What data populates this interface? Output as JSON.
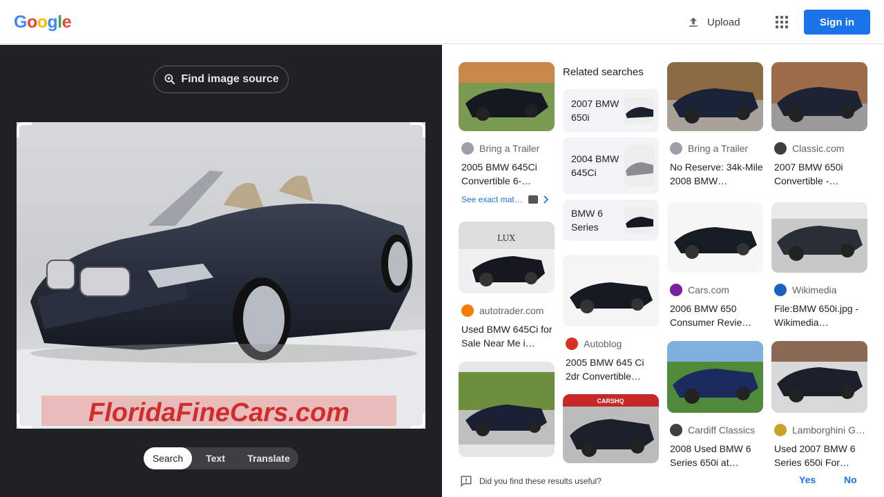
{
  "header": {
    "logo_letters": [
      {
        "ch": "G",
        "color": "#4285f4"
      },
      {
        "ch": "o",
        "color": "#ea4335"
      },
      {
        "ch": "o",
        "color": "#fbbc05"
      },
      {
        "ch": "g",
        "color": "#4285f4"
      },
      {
        "ch": "l",
        "color": "#34a853"
      },
      {
        "ch": "e",
        "color": "#ea4335"
      }
    ],
    "upload_label": "Upload",
    "signin_label": "Sign in",
    "upload_icon": "upload-icon",
    "apps_icon": "apps-grid-icon"
  },
  "left": {
    "find_source_label": "Find image source",
    "watermark": "FloridaFineCars.com",
    "tabs": [
      {
        "label": "Search",
        "active": true
      },
      {
        "label": "Text",
        "active": false
      },
      {
        "label": "Translate",
        "active": false
      }
    ]
  },
  "results": {
    "col1": [
      {
        "source": "Bring a Trailer",
        "title": "2005 BMW 645Ci Convertible 6-…",
        "fav_color": "#9aa0a6",
        "exact_label": "See exact mat…"
      },
      {
        "source": "autotrader.com",
        "title": "Used BMW 645Ci for Sale Near Me i…",
        "fav_color": "#f57c00"
      },
      {
        "source": "",
        "title": "",
        "fav_color": "#9aa0a6"
      }
    ],
    "related_head": "Related searches",
    "related": [
      "2007 BMW 650i",
      "2004 BMW 645Ci",
      "BMW 6 Series"
    ],
    "col2": [
      {
        "source": "Autoblog",
        "title": "2005 BMW 645 Ci 2dr Convertible…",
        "fav_color": "#d93025"
      },
      {
        "source": "",
        "title": "",
        "fav_color": "#9aa0a6",
        "sign_text": "CARSHQ"
      }
    ],
    "col3": [
      {
        "source": "Bring a Trailer",
        "title": "No Reserve: 34k-Mile 2008 BMW…",
        "fav_color": "#9aa0a6"
      },
      {
        "source": "Cars.com",
        "title": "2006 BMW 650 Consumer Revie…",
        "fav_color": "#7b1fa2"
      },
      {
        "source": "Cardiff Classics",
        "title": "2008 Used BMW 6 Series 650i at…",
        "fav_color": "#3c4043"
      }
    ],
    "col4": [
      {
        "source": "Classic.com",
        "title": "2007 BMW 650i Convertible -…",
        "fav_color": "#3c4043"
      },
      {
        "source": "Wikimedia",
        "title": "File:BMW 650i.jpg - Wikimedia…",
        "fav_color": "#1565c0"
      },
      {
        "source": "Lamborghini G…",
        "title": "Used 2007 BMW 6 Series 650i For…",
        "fav_color": "#c9a227"
      }
    ]
  },
  "footer": {
    "question": "Did you find these results useful?",
    "yes": "Yes",
    "no": "No"
  }
}
